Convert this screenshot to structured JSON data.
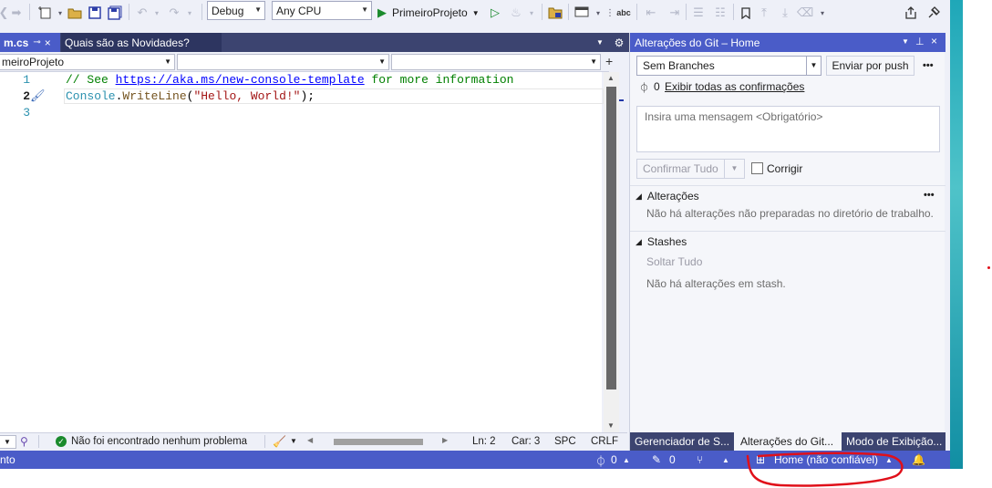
{
  "toolbar": {
    "configuration": "Debug",
    "platform": "Any CPU",
    "start_label": "PrimeiroProjeto",
    "icons": [
      "back-icon",
      "forward-icon",
      "new-item-icon",
      "open-folder-icon",
      "save-icon",
      "save-all-icon",
      "undo-icon",
      "redo-icon",
      "start-icon",
      "start-without-debug-icon",
      "hot-reload-icon",
      "solution-explorer-icon",
      "window-icon",
      "spellcheck-icon",
      "bookmark-icon",
      "share-icon",
      "feedback-icon"
    ],
    "spellcheck_label": "abc"
  },
  "editor": {
    "tabs": [
      {
        "label": "m.cs",
        "close": "×",
        "pin": "⊸"
      },
      {
        "label": "Quais são as Novidades?"
      }
    ],
    "nav": {
      "project": "meiroProjeto",
      "split": "+"
    },
    "lines": [
      {
        "num": "1",
        "parts": [
          {
            "t": "// See ",
            "c": "#008000"
          },
          {
            "t": "https://aka.ms/new-console-template",
            "c": "#0000ff",
            "u": true
          },
          {
            "t": " for more information",
            "c": "#008000"
          }
        ]
      },
      {
        "num": "2",
        "parts": [
          {
            "t": "Console",
            "c": "#2b91af"
          },
          {
            "t": ".",
            "c": "#000000"
          },
          {
            "t": "WriteLine",
            "c": "#74531f"
          },
          {
            "t": "(",
            "c": "#000000"
          },
          {
            "t": "\"Hello, World!\"",
            "c": "#a31515"
          },
          {
            "t": ");",
            "c": "#000000"
          }
        ]
      },
      {
        "num": "3",
        "parts": []
      }
    ],
    "status": {
      "issues": "Não foi encontrado nenhum problema",
      "ln": "Ln: 2",
      "car": "Car: 3",
      "spc": "SPC",
      "crlf": "CRLF"
    }
  },
  "git": {
    "title": "Alterações do Git – Home",
    "branch": "Sem Branches",
    "push": "Enviar por push",
    "more": "•••",
    "outgoing_count": "0",
    "view_all": "Exibir todas as confirmações",
    "message_placeholder": "Insira uma mensagem <Obrigatório>",
    "commit_all": "Confirmar Tudo",
    "amend": "Corrigir",
    "changes_header": "Alterações",
    "changes_empty": "Não há alterações não preparadas no diretório de trabalho.",
    "stashes_header": "Stashes",
    "drop_all": "Soltar Tudo",
    "stashes_empty": "Não há alterações em stash.",
    "bottom_tabs": [
      "Gerenciador de S...",
      "Alterações do Git...",
      "Modo de Exibição..."
    ]
  },
  "statusbar": {
    "left": "nto",
    "commits": "0",
    "edits": "0",
    "repo": "Home (não confiável)"
  },
  "colors": {
    "accent": "#4a5cc8",
    "annotation": "#e0101a"
  }
}
